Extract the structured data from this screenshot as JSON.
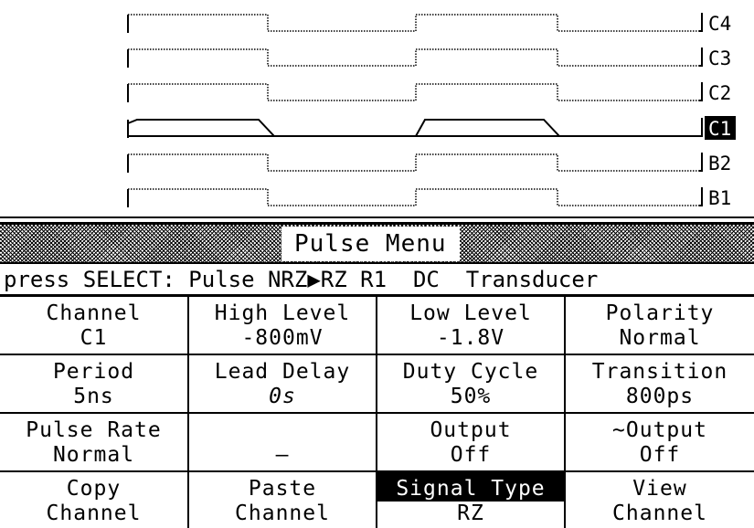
{
  "channels": [
    "C4",
    "C3",
    "C2",
    "C1",
    "B2",
    "B1"
  ],
  "selected_channel": "C1",
  "menu_title": "Pulse Menu",
  "select_prefix": "press SELECT: Pulse NRZ",
  "select_options": [
    "RZ",
    "R1",
    "DC",
    "Transducer"
  ],
  "select_marker_icon": "triangle-right-icon",
  "cells": [
    {
      "line1": "Channel",
      "line2": "C1"
    },
    {
      "line1": "High Level",
      "line2": "-800mV"
    },
    {
      "line1": "Low Level",
      "line2": "-1.8V"
    },
    {
      "line1": "Polarity",
      "line2": "Normal"
    },
    {
      "line1": "Period",
      "line2": "5ns"
    },
    {
      "line1": "Lead Delay",
      "line2": "0s"
    },
    {
      "line1": "Duty Cycle",
      "line2": "50%"
    },
    {
      "line1": "Transition",
      "line2": "800ps"
    },
    {
      "line1": "Pulse Rate",
      "line2": "Normal"
    },
    {
      "line1": "",
      "line2": "—"
    },
    {
      "line1": "Output",
      "line2": "Off"
    },
    {
      "line1": "~Output",
      "line2": "Off"
    },
    {
      "line1": "Copy",
      "line2": "Channel"
    },
    {
      "line1": "Paste",
      "line2": "Channel"
    },
    {
      "line1": "Signal Type",
      "line2": "RZ"
    },
    {
      "line1": "View",
      "line2": "Channel"
    }
  ]
}
